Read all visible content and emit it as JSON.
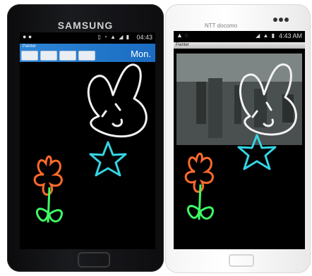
{
  "left_phone": {
    "brand": "SAMSUNG",
    "statusbar": {
      "time": "04:43"
    },
    "app": {
      "title": "Painter",
      "day_label": "Mon."
    }
  },
  "right_phone": {
    "brand": "NTT docomo",
    "statusbar": {
      "time": "4:43 AM"
    },
    "app": {
      "title": "Painter"
    }
  },
  "colors": {
    "phone_left_body": "#121316",
    "phone_right_body": "#f4f4f4",
    "appbar_blue": "#2e86d6",
    "doodle_white": "#f2f2f2",
    "star_cyan": "#35d4e3",
    "flower_orange": "#ff6a2a",
    "stem_green": "#3dfc63"
  }
}
